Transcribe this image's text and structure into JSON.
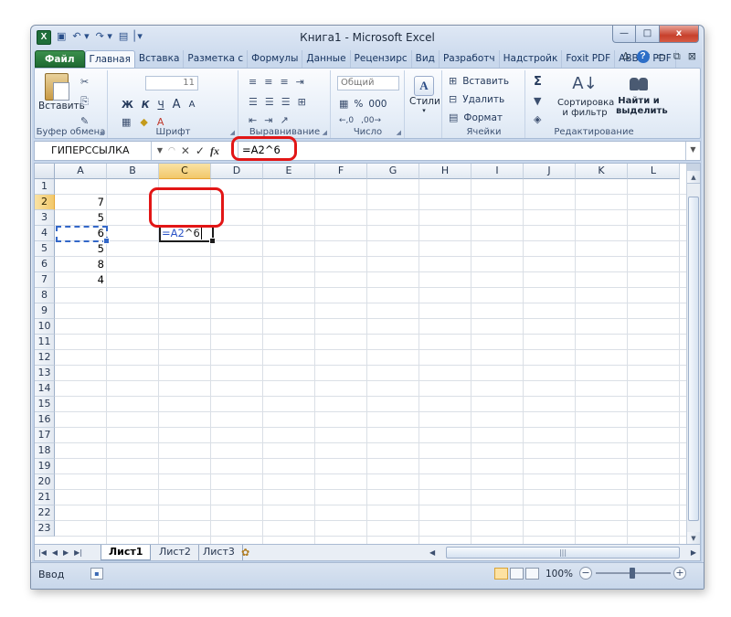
{
  "window": {
    "title": "Книга1  -  Microsoft Excel",
    "app_icon": "X",
    "controls": {
      "minimize": "—",
      "maximize": "□",
      "close": "x"
    }
  },
  "qat": {
    "save": "▣",
    "undo": "↶ ▾",
    "redo": "↷ ▾",
    "extra": "▤ │▾"
  },
  "ribbon_tabs": [
    "Файл",
    "Главная",
    "Вставка",
    "Разметка с",
    "Формулы",
    "Данные",
    "Рецензирс",
    "Вид",
    "Разработч",
    "Надстройк",
    "Foxit PDF",
    "ABBYY PDF"
  ],
  "ribbon_right": {
    "up": "∆",
    "help": "?",
    "restore": "▭",
    "copy": "⧉",
    "close": "⊠"
  },
  "ribbon": {
    "clipboard": {
      "paste": "Вставить",
      "label": "Буфер обмена"
    },
    "font": {
      "bold": "Ж",
      "italic": "К",
      "underline": "Ч",
      "size": "11",
      "grow": "A",
      "shrink": "A",
      "label": "Шрифт"
    },
    "alignment": {
      "label": "Выравнивание"
    },
    "number": {
      "format": "Общий",
      "percent": "%",
      "thousands": "000",
      "label": "Число"
    },
    "styles": {
      "label": "Стили",
      "icon": "A"
    },
    "cells": {
      "insert": "Вставить",
      "delete": "Удалить",
      "format": "Формат",
      "label": "Ячейки"
    },
    "editing": {
      "sum": "Σ",
      "sort": "Сортировка",
      "sort2": "и фильтр",
      "find": "Найти и",
      "find2": "выделить",
      "label": "Редактирование"
    }
  },
  "formula_bar": {
    "name_box": "ГИПЕРССЫЛКА",
    "cancel": "✕",
    "enter": "✓",
    "fx": "fx",
    "formula": "=A2^6"
  },
  "sheet": {
    "columns": [
      "A",
      "B",
      "C",
      "D",
      "E",
      "F",
      "G",
      "H",
      "I",
      "J",
      "K",
      "L"
    ],
    "rows": [
      "1",
      "2",
      "3",
      "4",
      "5",
      "6",
      "7",
      "8",
      "9",
      "10",
      "11",
      "12",
      "13",
      "14",
      "15",
      "16",
      "17",
      "18",
      "19",
      "20",
      "21",
      "22",
      "23"
    ],
    "col_a_values": [
      "7",
      "5",
      "6",
      "5",
      "8",
      "4"
    ],
    "edit_cell": {
      "ref": "=A2",
      "op": "^6"
    }
  },
  "sheet_tabs": [
    "Лист1",
    "Лист2",
    "Лист3"
  ],
  "status": {
    "mode": "Ввод",
    "zoom": "100%"
  },
  "colors": {
    "highlight_ring": "#e21616",
    "file_tab": "#1f6a32",
    "reference": "#2b54c7",
    "selected_header": "#f2c86a"
  }
}
